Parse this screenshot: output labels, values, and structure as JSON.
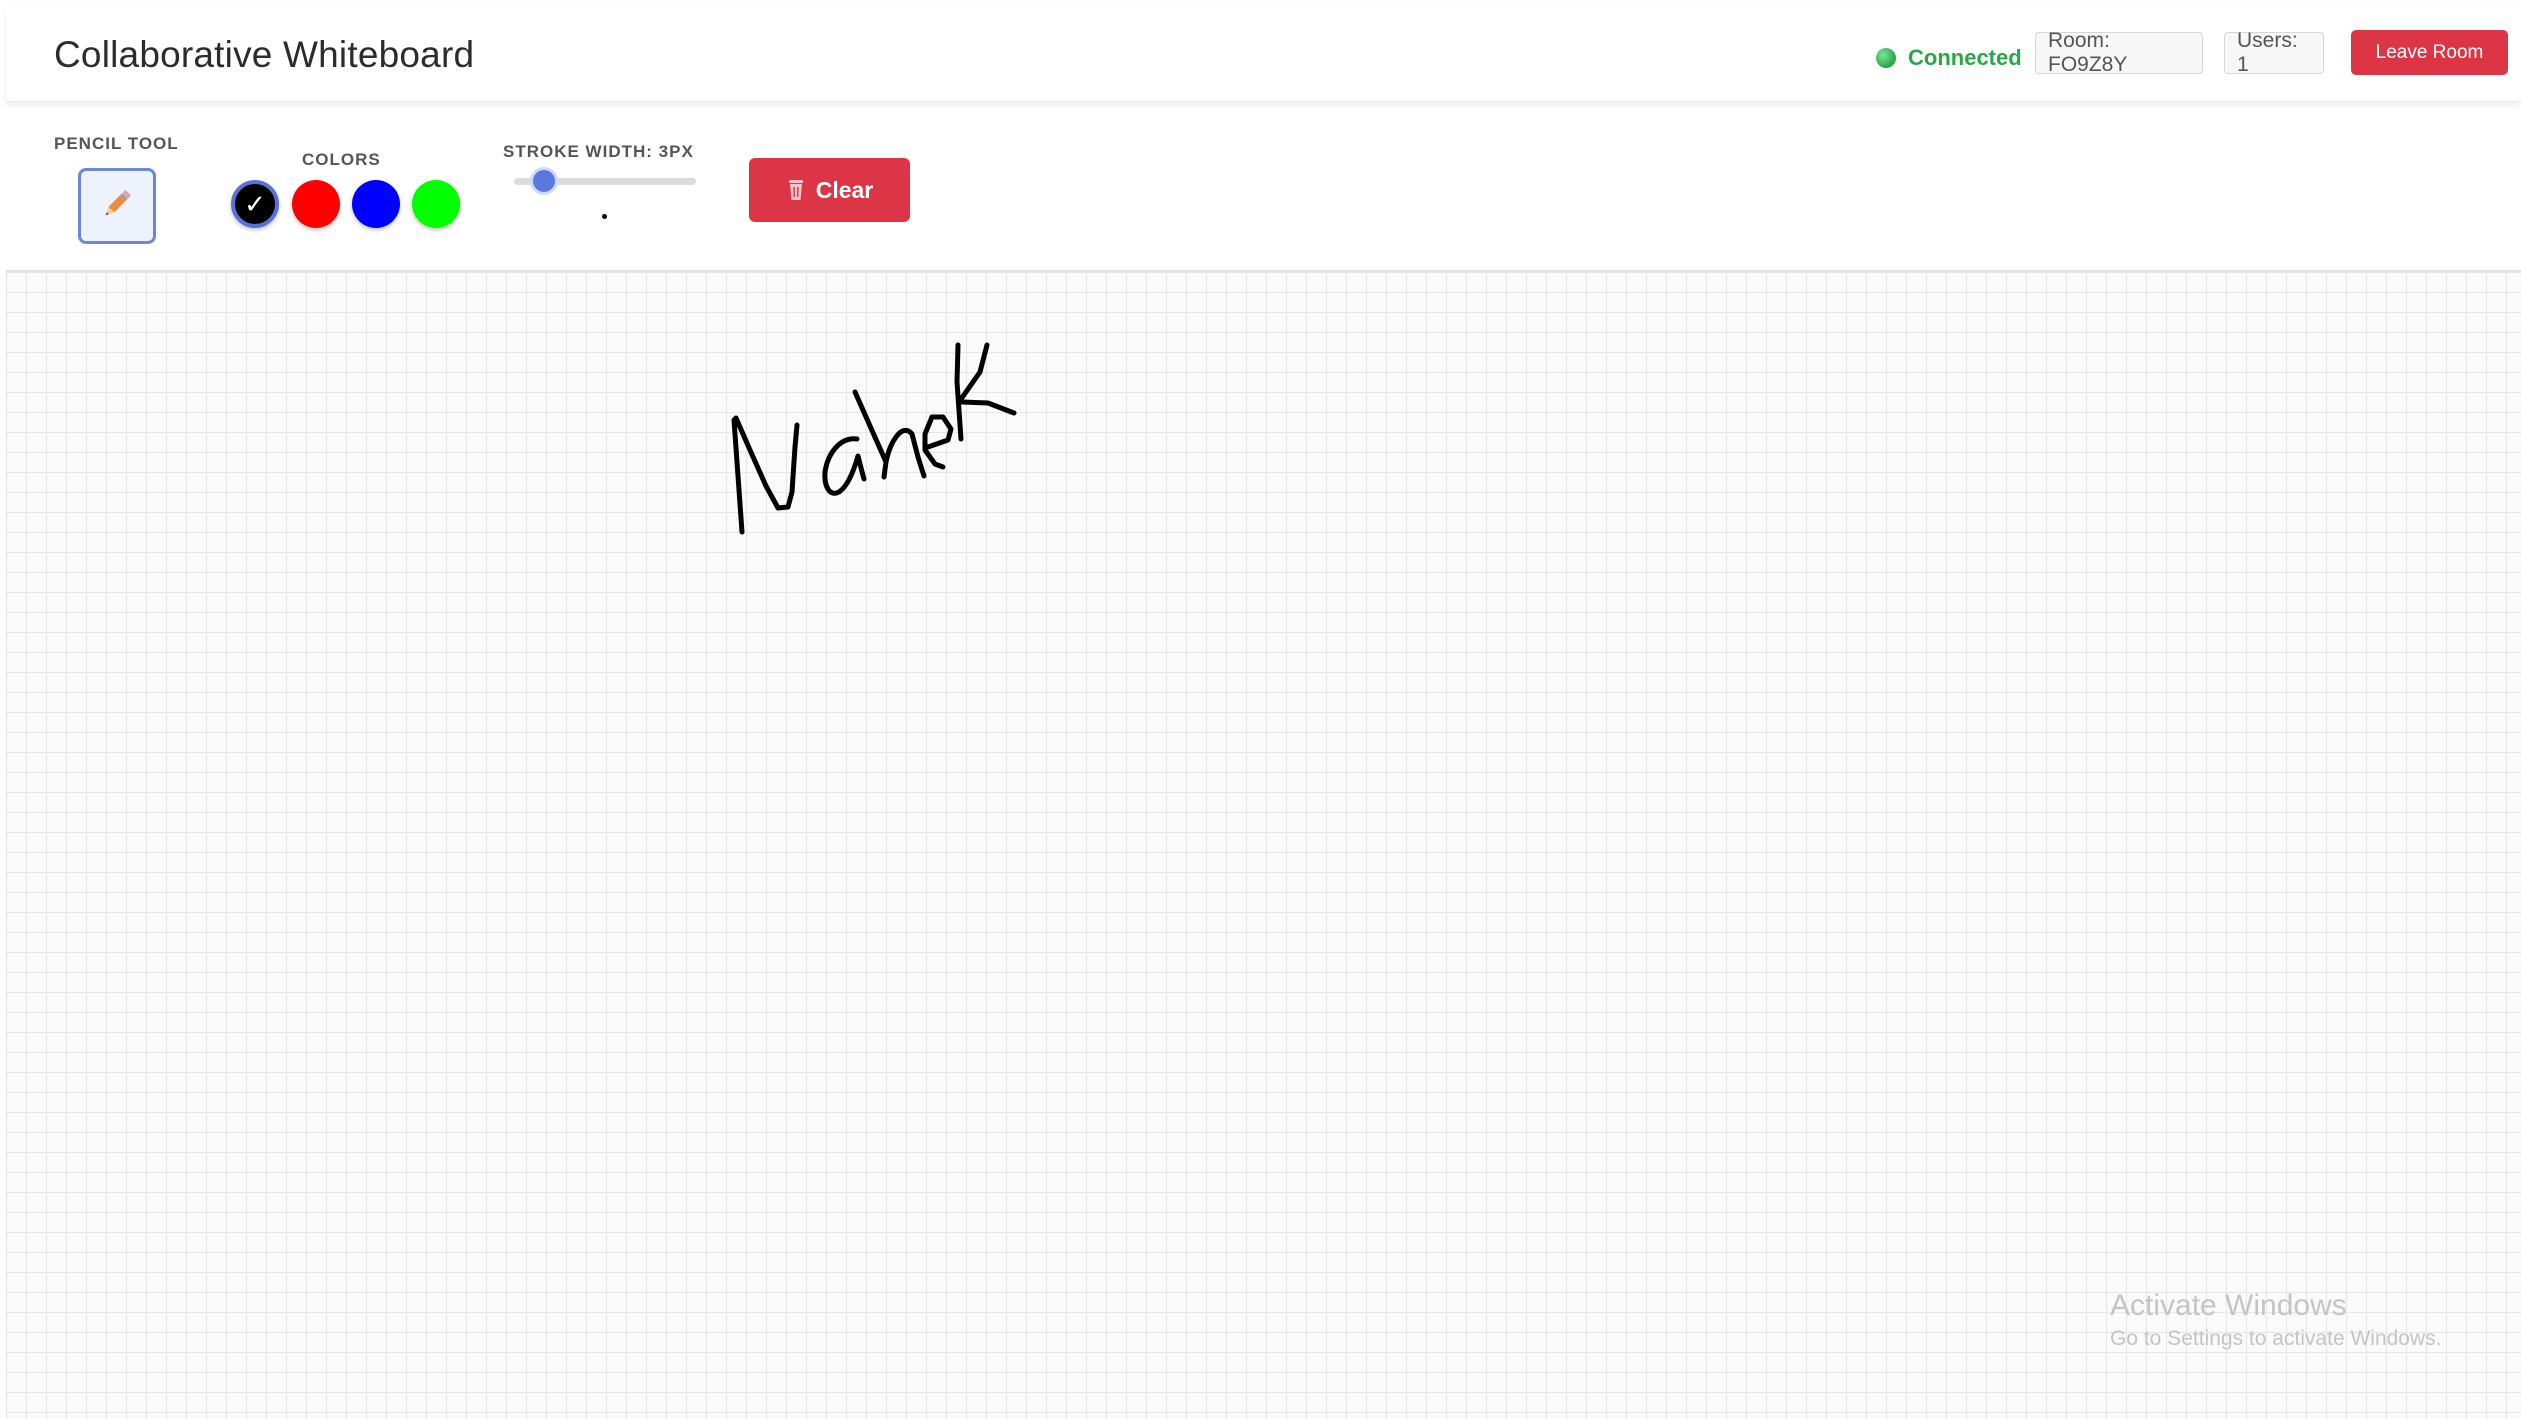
{
  "app": {
    "title": "Collaborative Whiteboard"
  },
  "header": {
    "status_text": "Connected",
    "status_color": "#28a745",
    "room_label": "Room: FO9Z8Y",
    "users_label": "Users: 1",
    "leave_label": "Leave Room"
  },
  "toolbar": {
    "pencil_label": "Pencil Tool",
    "colors_label": "Colors",
    "stroke_label": "Stroke Width: 3px",
    "clear_label": "Clear",
    "selected_check": "✓",
    "colors": [
      {
        "name": "black",
        "hex": "#000000",
        "selected": true
      },
      {
        "name": "red",
        "hex": "#ff0000",
        "selected": false
      },
      {
        "name": "blue",
        "hex": "#0000ff",
        "selected": false
      },
      {
        "name": "green",
        "hex": "#00ff00",
        "selected": false
      }
    ],
    "stroke_width": 3,
    "stroke_min": 1,
    "stroke_max": 20
  },
  "canvas": {
    "handwriting": "Mahek",
    "stroke_color": "#000000"
  },
  "watermark": {
    "title": "Activate Windows",
    "subtitle": "Go to Settings to activate Windows."
  }
}
